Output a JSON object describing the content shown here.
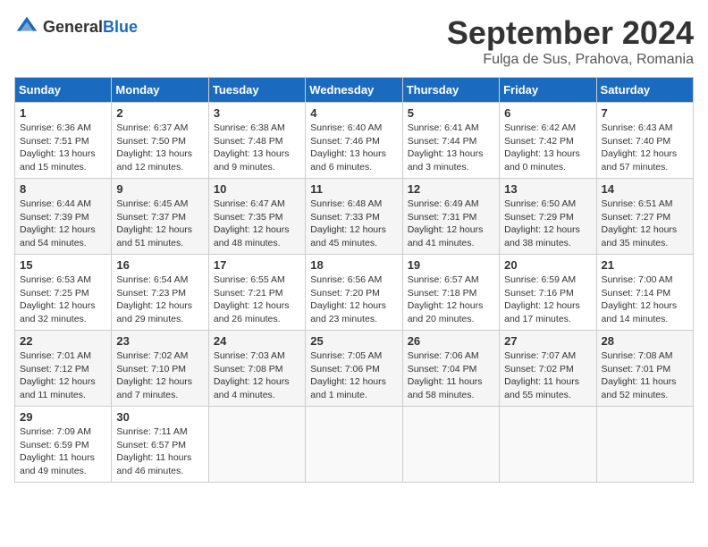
{
  "header": {
    "logo_general": "General",
    "logo_blue": "Blue",
    "month_title": "September 2024",
    "subtitle": "Fulga de Sus, Prahova, Romania"
  },
  "days_of_week": [
    "Sunday",
    "Monday",
    "Tuesday",
    "Wednesday",
    "Thursday",
    "Friday",
    "Saturday"
  ],
  "weeks": [
    [
      {
        "day": 1,
        "lines": [
          "Sunrise: 6:36 AM",
          "Sunset: 7:51 PM",
          "Daylight: 13 hours",
          "and 15 minutes."
        ]
      },
      {
        "day": 2,
        "lines": [
          "Sunrise: 6:37 AM",
          "Sunset: 7:50 PM",
          "Daylight: 13 hours",
          "and 12 minutes."
        ]
      },
      {
        "day": 3,
        "lines": [
          "Sunrise: 6:38 AM",
          "Sunset: 7:48 PM",
          "Daylight: 13 hours",
          "and 9 minutes."
        ]
      },
      {
        "day": 4,
        "lines": [
          "Sunrise: 6:40 AM",
          "Sunset: 7:46 PM",
          "Daylight: 13 hours",
          "and 6 minutes."
        ]
      },
      {
        "day": 5,
        "lines": [
          "Sunrise: 6:41 AM",
          "Sunset: 7:44 PM",
          "Daylight: 13 hours",
          "and 3 minutes."
        ]
      },
      {
        "day": 6,
        "lines": [
          "Sunrise: 6:42 AM",
          "Sunset: 7:42 PM",
          "Daylight: 13 hours",
          "and 0 minutes."
        ]
      },
      {
        "day": 7,
        "lines": [
          "Sunrise: 6:43 AM",
          "Sunset: 7:40 PM",
          "Daylight: 12 hours",
          "and 57 minutes."
        ]
      }
    ],
    [
      {
        "day": 8,
        "lines": [
          "Sunrise: 6:44 AM",
          "Sunset: 7:39 PM",
          "Daylight: 12 hours",
          "and 54 minutes."
        ]
      },
      {
        "day": 9,
        "lines": [
          "Sunrise: 6:45 AM",
          "Sunset: 7:37 PM",
          "Daylight: 12 hours",
          "and 51 minutes."
        ]
      },
      {
        "day": 10,
        "lines": [
          "Sunrise: 6:47 AM",
          "Sunset: 7:35 PM",
          "Daylight: 12 hours",
          "and 48 minutes."
        ]
      },
      {
        "day": 11,
        "lines": [
          "Sunrise: 6:48 AM",
          "Sunset: 7:33 PM",
          "Daylight: 12 hours",
          "and 45 minutes."
        ]
      },
      {
        "day": 12,
        "lines": [
          "Sunrise: 6:49 AM",
          "Sunset: 7:31 PM",
          "Daylight: 12 hours",
          "and 41 minutes."
        ]
      },
      {
        "day": 13,
        "lines": [
          "Sunrise: 6:50 AM",
          "Sunset: 7:29 PM",
          "Daylight: 12 hours",
          "and 38 minutes."
        ]
      },
      {
        "day": 14,
        "lines": [
          "Sunrise: 6:51 AM",
          "Sunset: 7:27 PM",
          "Daylight: 12 hours",
          "and 35 minutes."
        ]
      }
    ],
    [
      {
        "day": 15,
        "lines": [
          "Sunrise: 6:53 AM",
          "Sunset: 7:25 PM",
          "Daylight: 12 hours",
          "and 32 minutes."
        ]
      },
      {
        "day": 16,
        "lines": [
          "Sunrise: 6:54 AM",
          "Sunset: 7:23 PM",
          "Daylight: 12 hours",
          "and 29 minutes."
        ]
      },
      {
        "day": 17,
        "lines": [
          "Sunrise: 6:55 AM",
          "Sunset: 7:21 PM",
          "Daylight: 12 hours",
          "and 26 minutes."
        ]
      },
      {
        "day": 18,
        "lines": [
          "Sunrise: 6:56 AM",
          "Sunset: 7:20 PM",
          "Daylight: 12 hours",
          "and 23 minutes."
        ]
      },
      {
        "day": 19,
        "lines": [
          "Sunrise: 6:57 AM",
          "Sunset: 7:18 PM",
          "Daylight: 12 hours",
          "and 20 minutes."
        ]
      },
      {
        "day": 20,
        "lines": [
          "Sunrise: 6:59 AM",
          "Sunset: 7:16 PM",
          "Daylight: 12 hours",
          "and 17 minutes."
        ]
      },
      {
        "day": 21,
        "lines": [
          "Sunrise: 7:00 AM",
          "Sunset: 7:14 PM",
          "Daylight: 12 hours",
          "and 14 minutes."
        ]
      }
    ],
    [
      {
        "day": 22,
        "lines": [
          "Sunrise: 7:01 AM",
          "Sunset: 7:12 PM",
          "Daylight: 12 hours",
          "and 11 minutes."
        ]
      },
      {
        "day": 23,
        "lines": [
          "Sunrise: 7:02 AM",
          "Sunset: 7:10 PM",
          "Daylight: 12 hours",
          "and 7 minutes."
        ]
      },
      {
        "day": 24,
        "lines": [
          "Sunrise: 7:03 AM",
          "Sunset: 7:08 PM",
          "Daylight: 12 hours",
          "and 4 minutes."
        ]
      },
      {
        "day": 25,
        "lines": [
          "Sunrise: 7:05 AM",
          "Sunset: 7:06 PM",
          "Daylight: 12 hours",
          "and 1 minute."
        ]
      },
      {
        "day": 26,
        "lines": [
          "Sunrise: 7:06 AM",
          "Sunset: 7:04 PM",
          "Daylight: 11 hours",
          "and 58 minutes."
        ]
      },
      {
        "day": 27,
        "lines": [
          "Sunrise: 7:07 AM",
          "Sunset: 7:02 PM",
          "Daylight: 11 hours",
          "and 55 minutes."
        ]
      },
      {
        "day": 28,
        "lines": [
          "Sunrise: 7:08 AM",
          "Sunset: 7:01 PM",
          "Daylight: 11 hours",
          "and 52 minutes."
        ]
      }
    ],
    [
      {
        "day": 29,
        "lines": [
          "Sunrise: 7:09 AM",
          "Sunset: 6:59 PM",
          "Daylight: 11 hours",
          "and 49 minutes."
        ]
      },
      {
        "day": 30,
        "lines": [
          "Sunrise: 7:11 AM",
          "Sunset: 6:57 PM",
          "Daylight: 11 hours",
          "and 46 minutes."
        ]
      },
      null,
      null,
      null,
      null,
      null
    ]
  ]
}
